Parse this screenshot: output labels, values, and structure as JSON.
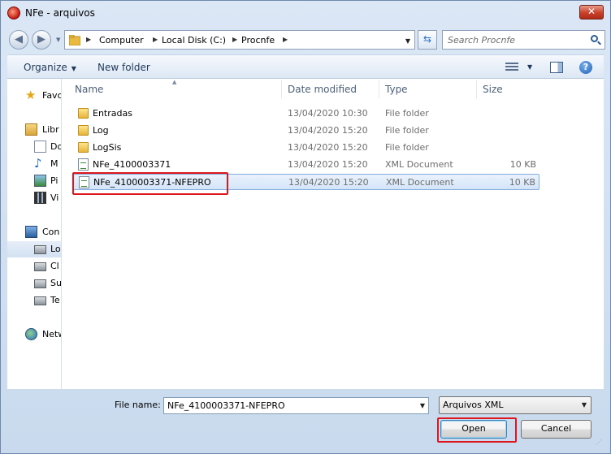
{
  "window": {
    "title": "NFe - arquivos",
    "close_label": "✕"
  },
  "navigation": {
    "back_glyph": "◀",
    "forward_glyph": "▶",
    "breadcrumb": [
      "Computer",
      "Local Disk (C:)",
      "Procnfe"
    ],
    "search_placeholder": "Search Procnfe"
  },
  "toolbar": {
    "organize_label": "Organize",
    "new_folder_label": "New folder"
  },
  "nav_pane": {
    "items": [
      {
        "label": "Favo",
        "icon": "star-icon"
      },
      {
        "label": "Libr",
        "icon": "libraries-icon"
      },
      {
        "label": "Do",
        "icon": "documents-icon"
      },
      {
        "label": "M",
        "icon": "music-icon"
      },
      {
        "label": "Pi",
        "icon": "pictures-icon"
      },
      {
        "label": "Vi",
        "icon": "videos-icon"
      },
      {
        "label": "Con",
        "icon": "computer-icon"
      },
      {
        "label": "Lo",
        "icon": "local-disk-icon",
        "selected": true
      },
      {
        "label": "Cl",
        "icon": "network-drive-icon"
      },
      {
        "label": "Su",
        "icon": "network-drive-icon"
      },
      {
        "label": "Te",
        "icon": "network-drive-icon"
      },
      {
        "label": "Netw",
        "icon": "network-icon"
      }
    ]
  },
  "file_list": {
    "columns": {
      "name": "Name",
      "date": "Date modified",
      "type": "Type",
      "size": "Size"
    },
    "rows": [
      {
        "name": "Entradas",
        "date": "13/04/2020 10:30",
        "type": "File folder",
        "size": "",
        "icon": "folder-icon"
      },
      {
        "name": "Log",
        "date": "13/04/2020 15:20",
        "type": "File folder",
        "size": "",
        "icon": "folder-icon"
      },
      {
        "name": "LogSis",
        "date": "13/04/2020 15:20",
        "type": "File folder",
        "size": "",
        "icon": "folder-icon"
      },
      {
        "name": "NFe_4100003371",
        "date": "13/04/2020 15:20",
        "type": "XML Document",
        "size": "10 KB",
        "icon": "xml-file-icon"
      },
      {
        "name": "NFe_4100003371-NFEPRO",
        "date": "13/04/2020 15:20",
        "type": "XML Document",
        "size": "10 KB",
        "icon": "xml-file-icon",
        "selected": true
      }
    ]
  },
  "bottom": {
    "file_name_label": "File name:",
    "file_name_value": "NFe_4100003371-NFEPRO",
    "filter_value": "Arquivos XML",
    "open_label": "Open",
    "cancel_label": "Cancel"
  },
  "colors": {
    "highlight": "#e0161f",
    "selection": "#d4e5f9",
    "toolbar_text": "#1e395b"
  }
}
